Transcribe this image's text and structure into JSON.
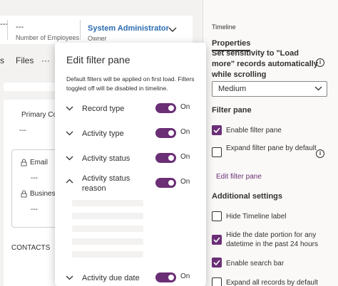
{
  "form": {
    "header": {
      "fields": [
        {
          "value": "---",
          "label": "Number of Employees"
        },
        {
          "value": "System Administrator",
          "label": "Owner"
        }
      ],
      "left_value": "---",
      "left_label": ""
    },
    "tabs": [
      "s",
      "Files",
      "···"
    ],
    "primary_contact_label": "Primary Co",
    "primary_contact_value": "---",
    "email_label": "Email",
    "email_value": "---",
    "business_label": "Business",
    "business_value": "---",
    "contacts_heading": "CONTACTS"
  },
  "popup": {
    "title": "Edit filter pane",
    "description": "Default filters will be applied on first load. Filters toggled off will be disabled in timeline.",
    "filters": [
      {
        "label": "Record type",
        "state": "On",
        "expanded": false
      },
      {
        "label": "Activity type",
        "state": "On",
        "expanded": false
      },
      {
        "label": "Activity status",
        "state": "On",
        "expanded": false
      },
      {
        "label": "Activity status reason",
        "state": "On",
        "expanded": true
      },
      {
        "label": "Activity due date",
        "state": "On",
        "expanded": false
      }
    ]
  },
  "settings": {
    "pane_title": "Timeline",
    "tab": "Properties",
    "sensitivity_label": "Set sensitivity to \"Load more\" records automatically while scrolling",
    "sensitivity_value": "Medium",
    "filter_pane_heading": "Filter pane",
    "enable_filter_pane": {
      "label": "Enable filter pane",
      "checked": true
    },
    "expand_filter_pane": {
      "label": "Expand filter pane by default",
      "checked": false
    },
    "edit_filter_link": "Edit filter pane",
    "additional_heading": "Additional settings",
    "hide_timeline_label": {
      "label": "Hide Timeline label",
      "checked": false
    },
    "hide_date_portion": {
      "label": "Hide the date portion for any datetime in the past 24 hours",
      "checked": true
    },
    "enable_search_bar": {
      "label": "Enable search bar",
      "checked": true
    },
    "expand_all_records": {
      "label": "Expand all records by default",
      "checked": false
    }
  },
  "colors": {
    "accent": "#6b2f76",
    "link": "#2b6cb0"
  }
}
